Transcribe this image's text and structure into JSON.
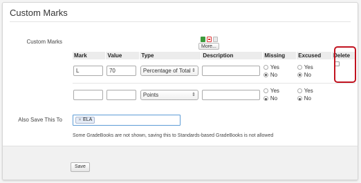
{
  "panel": {
    "title": "Custom Marks"
  },
  "custom_marks_label": "Custom Marks",
  "export": {
    "icons": [
      "spreadsheet-icon",
      "pdf-icon",
      "document-icon"
    ],
    "more_label": "More..."
  },
  "table": {
    "headers": [
      "Mark",
      "Value",
      "Type",
      "Description",
      "Missing",
      "Excused",
      "Delete"
    ],
    "rows": [
      {
        "mark": "L",
        "value": "70",
        "type": "Percentage of Total",
        "description": "",
        "missing": {
          "yes": "Yes",
          "no": "No",
          "selected": "No"
        },
        "excused": {
          "yes": "Yes",
          "no": "No",
          "selected": "No"
        },
        "delete_checked": false
      },
      {
        "mark": "",
        "value": "",
        "type": "Points",
        "description": "",
        "missing": {
          "yes": "Yes",
          "no": "No",
          "selected": "No"
        },
        "excused": {
          "yes": "Yes",
          "no": "No",
          "selected": "No"
        },
        "delete_checked": null
      }
    ]
  },
  "also_save": {
    "label": "Also Save This To",
    "tokens": [
      "ELA"
    ]
  },
  "note": "Some GradeBooks are not shown, saving this to Standards-based GradeBooks is not allowed",
  "footer": {
    "save_label": "Save"
  },
  "colors": {
    "highlight": "#c1121f",
    "focus_border": "#5b9bd5"
  }
}
